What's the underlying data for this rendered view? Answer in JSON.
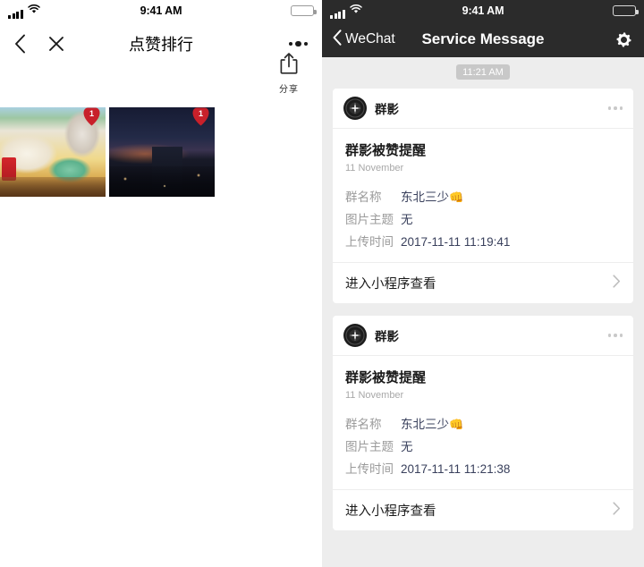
{
  "left_panel": {
    "status_bar": {
      "time": "9:41 AM",
      "signal_icon": "signal-bars-icon",
      "wifi_icon": "wifi-icon",
      "battery_icon": "battery-full-icon"
    },
    "nav": {
      "back_icon": "chevron-left-icon",
      "close_icon": "close-x-icon",
      "title": "点赞排行",
      "menu_icon": "more-dots-icon"
    },
    "share": {
      "icon": "share-upload-icon",
      "label": "分享"
    },
    "photos": [
      {
        "name": "photo-mcdonalds-meal",
        "like_count": "1",
        "badge_icon": "heart-badge-icon"
      },
      {
        "name": "photo-night-cityscape",
        "like_count": "1",
        "badge_icon": "heart-badge-icon"
      }
    ]
  },
  "right_panel": {
    "status_bar": {
      "time": "9:41 AM",
      "signal_icon": "signal-bars-icon",
      "wifi_icon": "wifi-icon",
      "battery_icon": "battery-full-icon"
    },
    "nav": {
      "back_icon": "chevron-left-icon",
      "back_label": "WeChat",
      "title": "Service Message",
      "settings_icon": "gear-icon"
    },
    "timestamp_pill": "11:21 AM",
    "messages": [
      {
        "avatar_icon": "qunying-app-avatar-icon",
        "app_name": "群影",
        "menu_icon": "more-dots-icon",
        "title": "群影被赞提醒",
        "date": "11 November",
        "details": [
          {
            "label": "群名称",
            "value": "东北三少",
            "emoji": "👊"
          },
          {
            "label": "图片主题",
            "value": "无",
            "emoji": ""
          },
          {
            "label": "上传时间",
            "value": "2017-11-11 11:19:41",
            "emoji": ""
          }
        ],
        "footer_label": "进入小程序查看",
        "footer_icon": "chevron-right-icon"
      },
      {
        "avatar_icon": "qunying-app-avatar-icon",
        "app_name": "群影",
        "menu_icon": "more-dots-icon",
        "title": "群影被赞提醒",
        "date": "11 November",
        "details": [
          {
            "label": "群名称",
            "value": "东北三少",
            "emoji": "👊"
          },
          {
            "label": "图片主题",
            "value": "无",
            "emoji": ""
          },
          {
            "label": "上传时间",
            "value": "2017-11-11 11:21:38",
            "emoji": ""
          }
        ],
        "footer_label": "进入小程序查看",
        "footer_icon": "chevron-right-icon"
      }
    ]
  },
  "colors": {
    "navbar_dark": "#2b2b2b",
    "chat_background": "#ededed",
    "card_white": "#ffffff",
    "detail_value": "#39405c",
    "detail_label": "#9b9b9b",
    "badge_red": "#c8202a",
    "time_pill": "#c8c8c8"
  }
}
